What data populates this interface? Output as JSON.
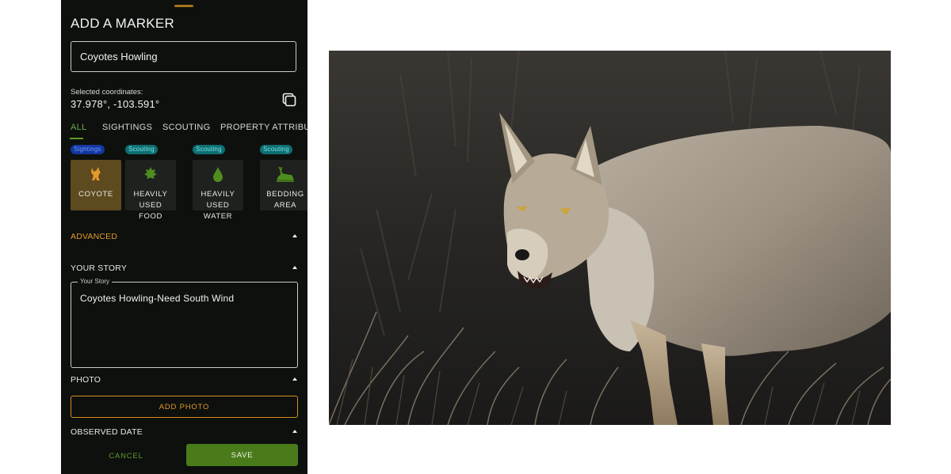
{
  "panel": {
    "title": "ADD A MARKER",
    "marker_name": "Coyotes Howling",
    "coords_label": "Selected coordinates:",
    "coords_value": "37.978°, -103.591°",
    "tabs": [
      {
        "label": "ALL",
        "active": true
      },
      {
        "label": "SIGHTINGS",
        "active": false
      },
      {
        "label": "SCOUTING",
        "active": false
      },
      {
        "label": "PROPERTY ATTRIBUTE",
        "active": false
      }
    ],
    "markers": [
      {
        "badge": "Sightings",
        "label": "COYOTE",
        "icon": "coyote-icon",
        "selected": true
      },
      {
        "badge": "Scouting",
        "label": "HEAVILY USED\nFOOD",
        "icon": "leaf-icon",
        "selected": false
      },
      {
        "badge": "Scouting",
        "label": "HEAVILY USED\nWATER",
        "icon": "water-drop-icon",
        "selected": false
      },
      {
        "badge": "Scouting",
        "label": "BEDDING\nAREA",
        "icon": "bedding-deer-icon",
        "selected": false
      }
    ],
    "advanced_label": "ADVANCED",
    "your_story_label": "YOUR STORY",
    "story_field_label": "Your Story",
    "story_text": "Coyotes Howling-Need South Wind",
    "photo_label": "PHOTO",
    "add_photo_label": "ADD PHOTO",
    "observed_date_label": "OBSERVED DATE",
    "cancel_label": "CANCEL",
    "save_label": "SAVE"
  },
  "colors": {
    "panel_bg": "#0d100d",
    "accent_green": "#5e9b2b",
    "accent_orange": "#e3992c",
    "selected_tile": "#5e4a1f",
    "sightings_badge": "#14369e",
    "scouting_badge": "#0e6f72"
  }
}
